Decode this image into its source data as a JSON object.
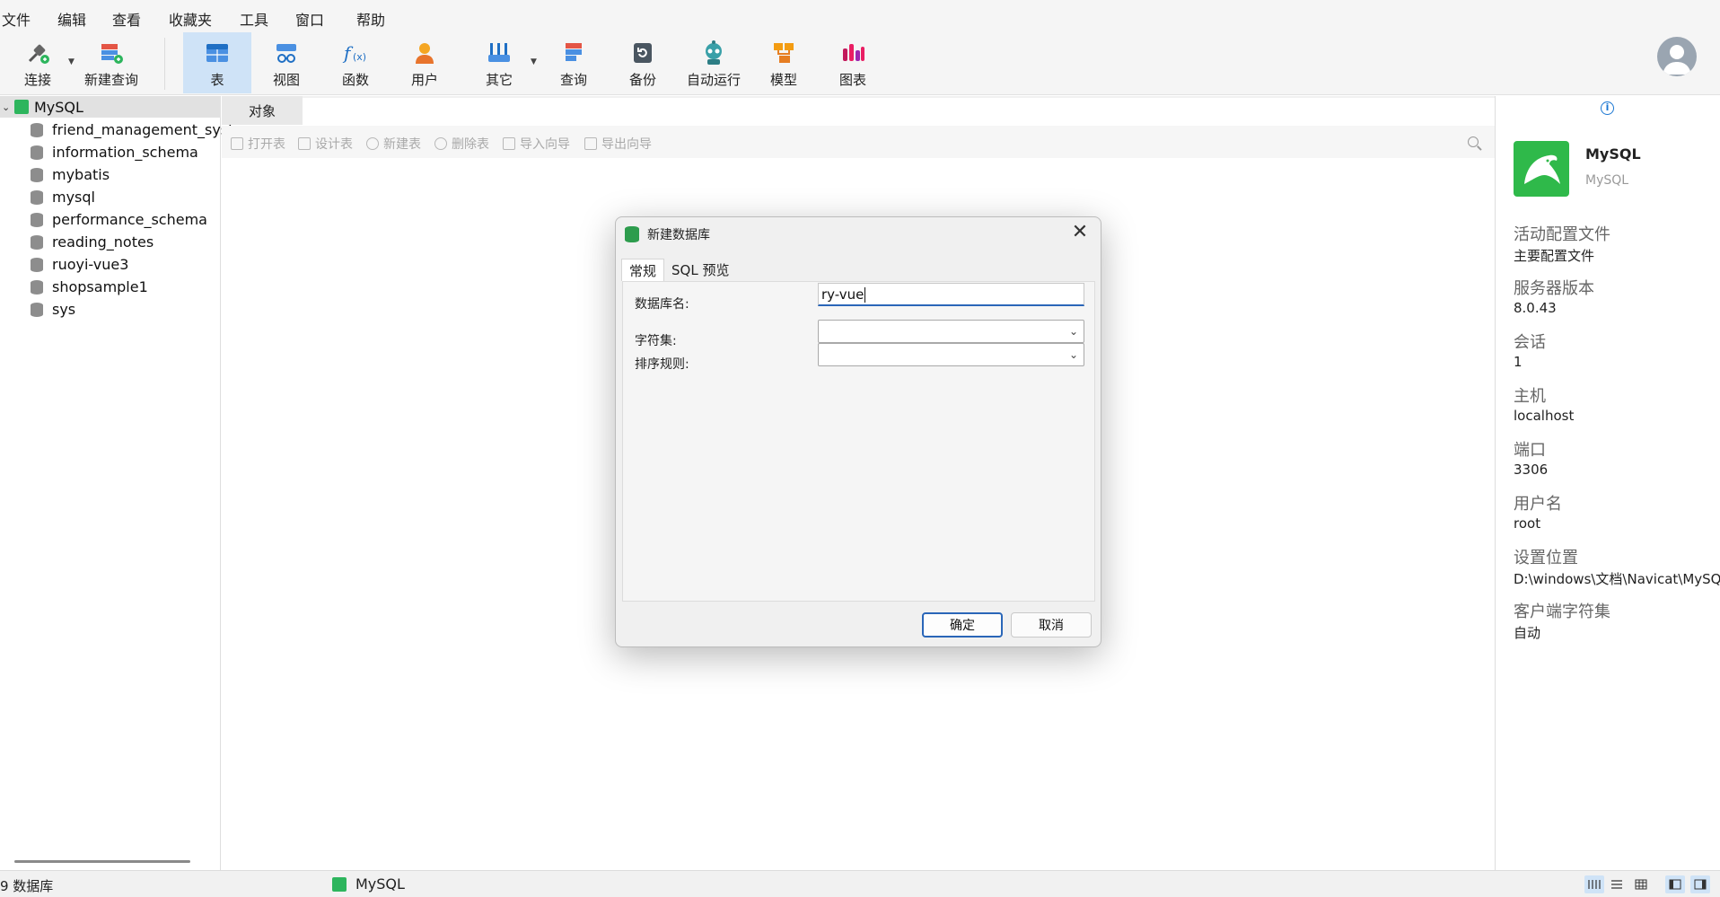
{
  "menu": [
    "文件",
    "编辑",
    "查看",
    "收藏夹",
    "工具",
    "窗口",
    "帮助"
  ],
  "toolbar": {
    "connect": "连接",
    "new_query": "新建查询",
    "table": "表",
    "view": "视图",
    "function": "函数",
    "user": "用户",
    "other": "其它",
    "query": "查询",
    "backup": "备份",
    "automation": "自动运行",
    "model": "模型",
    "chart": "图表"
  },
  "navigator": {
    "connection": "MySQL",
    "databases": [
      "friend_management_syste",
      "information_schema",
      "mybatis",
      "mysql",
      "performance_schema",
      "reading_notes",
      "ruoyi-vue3",
      "shopsample1",
      "sys"
    ]
  },
  "main": {
    "tab": "对象",
    "actions": {
      "open_table": "打开表",
      "design_table": "设计表",
      "new_table": "新建表",
      "delete_table": "删除表",
      "import_wizard": "导入向导",
      "export_wizard": "导出向导"
    }
  },
  "dialog": {
    "title": "新建数据库",
    "tabs": [
      "常规",
      "SQL 预览"
    ],
    "db_name_label": "数据库名:",
    "db_name_value": "ry-vue",
    "charset_label": "字符集:",
    "charset_value": "",
    "collation_label": "排序规则:",
    "collation_value": "",
    "ok": "确定",
    "cancel": "取消"
  },
  "info": {
    "name": "MySQL",
    "type": "MySQL",
    "fields": [
      {
        "label": "活动配置文件",
        "value": "主要配置文件"
      },
      {
        "label": "服务器版本",
        "value": "8.0.43"
      },
      {
        "label": "会话",
        "value": "1"
      },
      {
        "label": "主机",
        "value": "localhost"
      },
      {
        "label": "端口",
        "value": "3306"
      },
      {
        "label": "用户名",
        "value": "root"
      },
      {
        "label": "设置位置",
        "value": "D:\\windows\\文档\\Navicat\\MySQL"
      },
      {
        "label": "客户端字符集",
        "value": "自动"
      }
    ]
  },
  "status": {
    "db_count": "9 数据库",
    "connection": "MySQL"
  },
  "colors": {
    "accent": "#2a66b8",
    "active_bg": "#cfe3f7",
    "mysql_green": "#2fb94a"
  }
}
